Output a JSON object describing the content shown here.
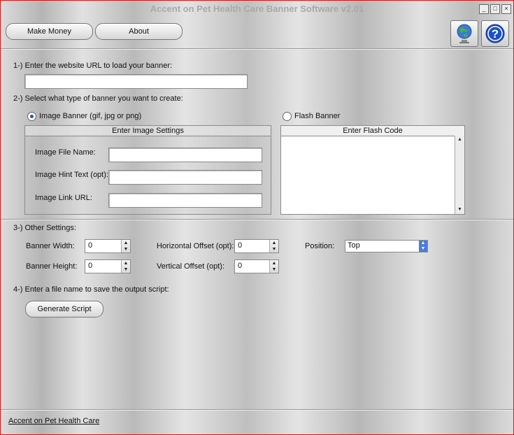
{
  "window": {
    "title": "Accent on Pet Health Care Banner Software v2.01",
    "minimize": "_",
    "maximize": "□",
    "close": "×"
  },
  "toolbar": {
    "make_money_label": "Make Money",
    "about_label": "About"
  },
  "step1": {
    "label": "1-) Enter the website URL to load your banner:",
    "url_value": ""
  },
  "step2": {
    "label": "2-) Select what type of banner you want to create:",
    "image_banner_label": "Image Banner (gif, jpg or png)",
    "image_banner_selected": true,
    "flash_banner_label": "Flash Banner",
    "flash_banner_selected": false,
    "image_panel": {
      "title": "Enter Image Settings",
      "file_name_label": "Image File Name:",
      "hint_text_label": "Image Hint Text (opt):",
      "link_url_label": "Image Link URL:",
      "file_name_value": "",
      "hint_text_value": "",
      "link_url_value": ""
    },
    "flash_panel": {
      "title": "Enter Flash Code",
      "code_value": ""
    }
  },
  "step3": {
    "label": "3-) Other Settings:",
    "banner_width_label": "Banner Width:",
    "banner_width_value": "0",
    "banner_height_label": "Banner Height:",
    "banner_height_value": "0",
    "horizontal_offset_label": "Horizontal Offset (opt):",
    "horizontal_offset_value": "0",
    "vertical_offset_label": "Vertical Offset (opt):",
    "vertical_offset_value": "0",
    "position_label": "Position:",
    "position_value": "Top"
  },
  "step4": {
    "label": "4-) Enter a file name to save the output script:",
    "generate_label": "Generate Script"
  },
  "footer": {
    "link_text": "Accent on Pet Health Care"
  },
  "colors": {
    "window_border": "#e01010",
    "radio_selected": "#2a4fb0",
    "select_arrow": "#4a7be0",
    "help_icon": "#1a4fcf"
  },
  "icons": {
    "globe": "globe-icon",
    "help": "help-icon"
  }
}
